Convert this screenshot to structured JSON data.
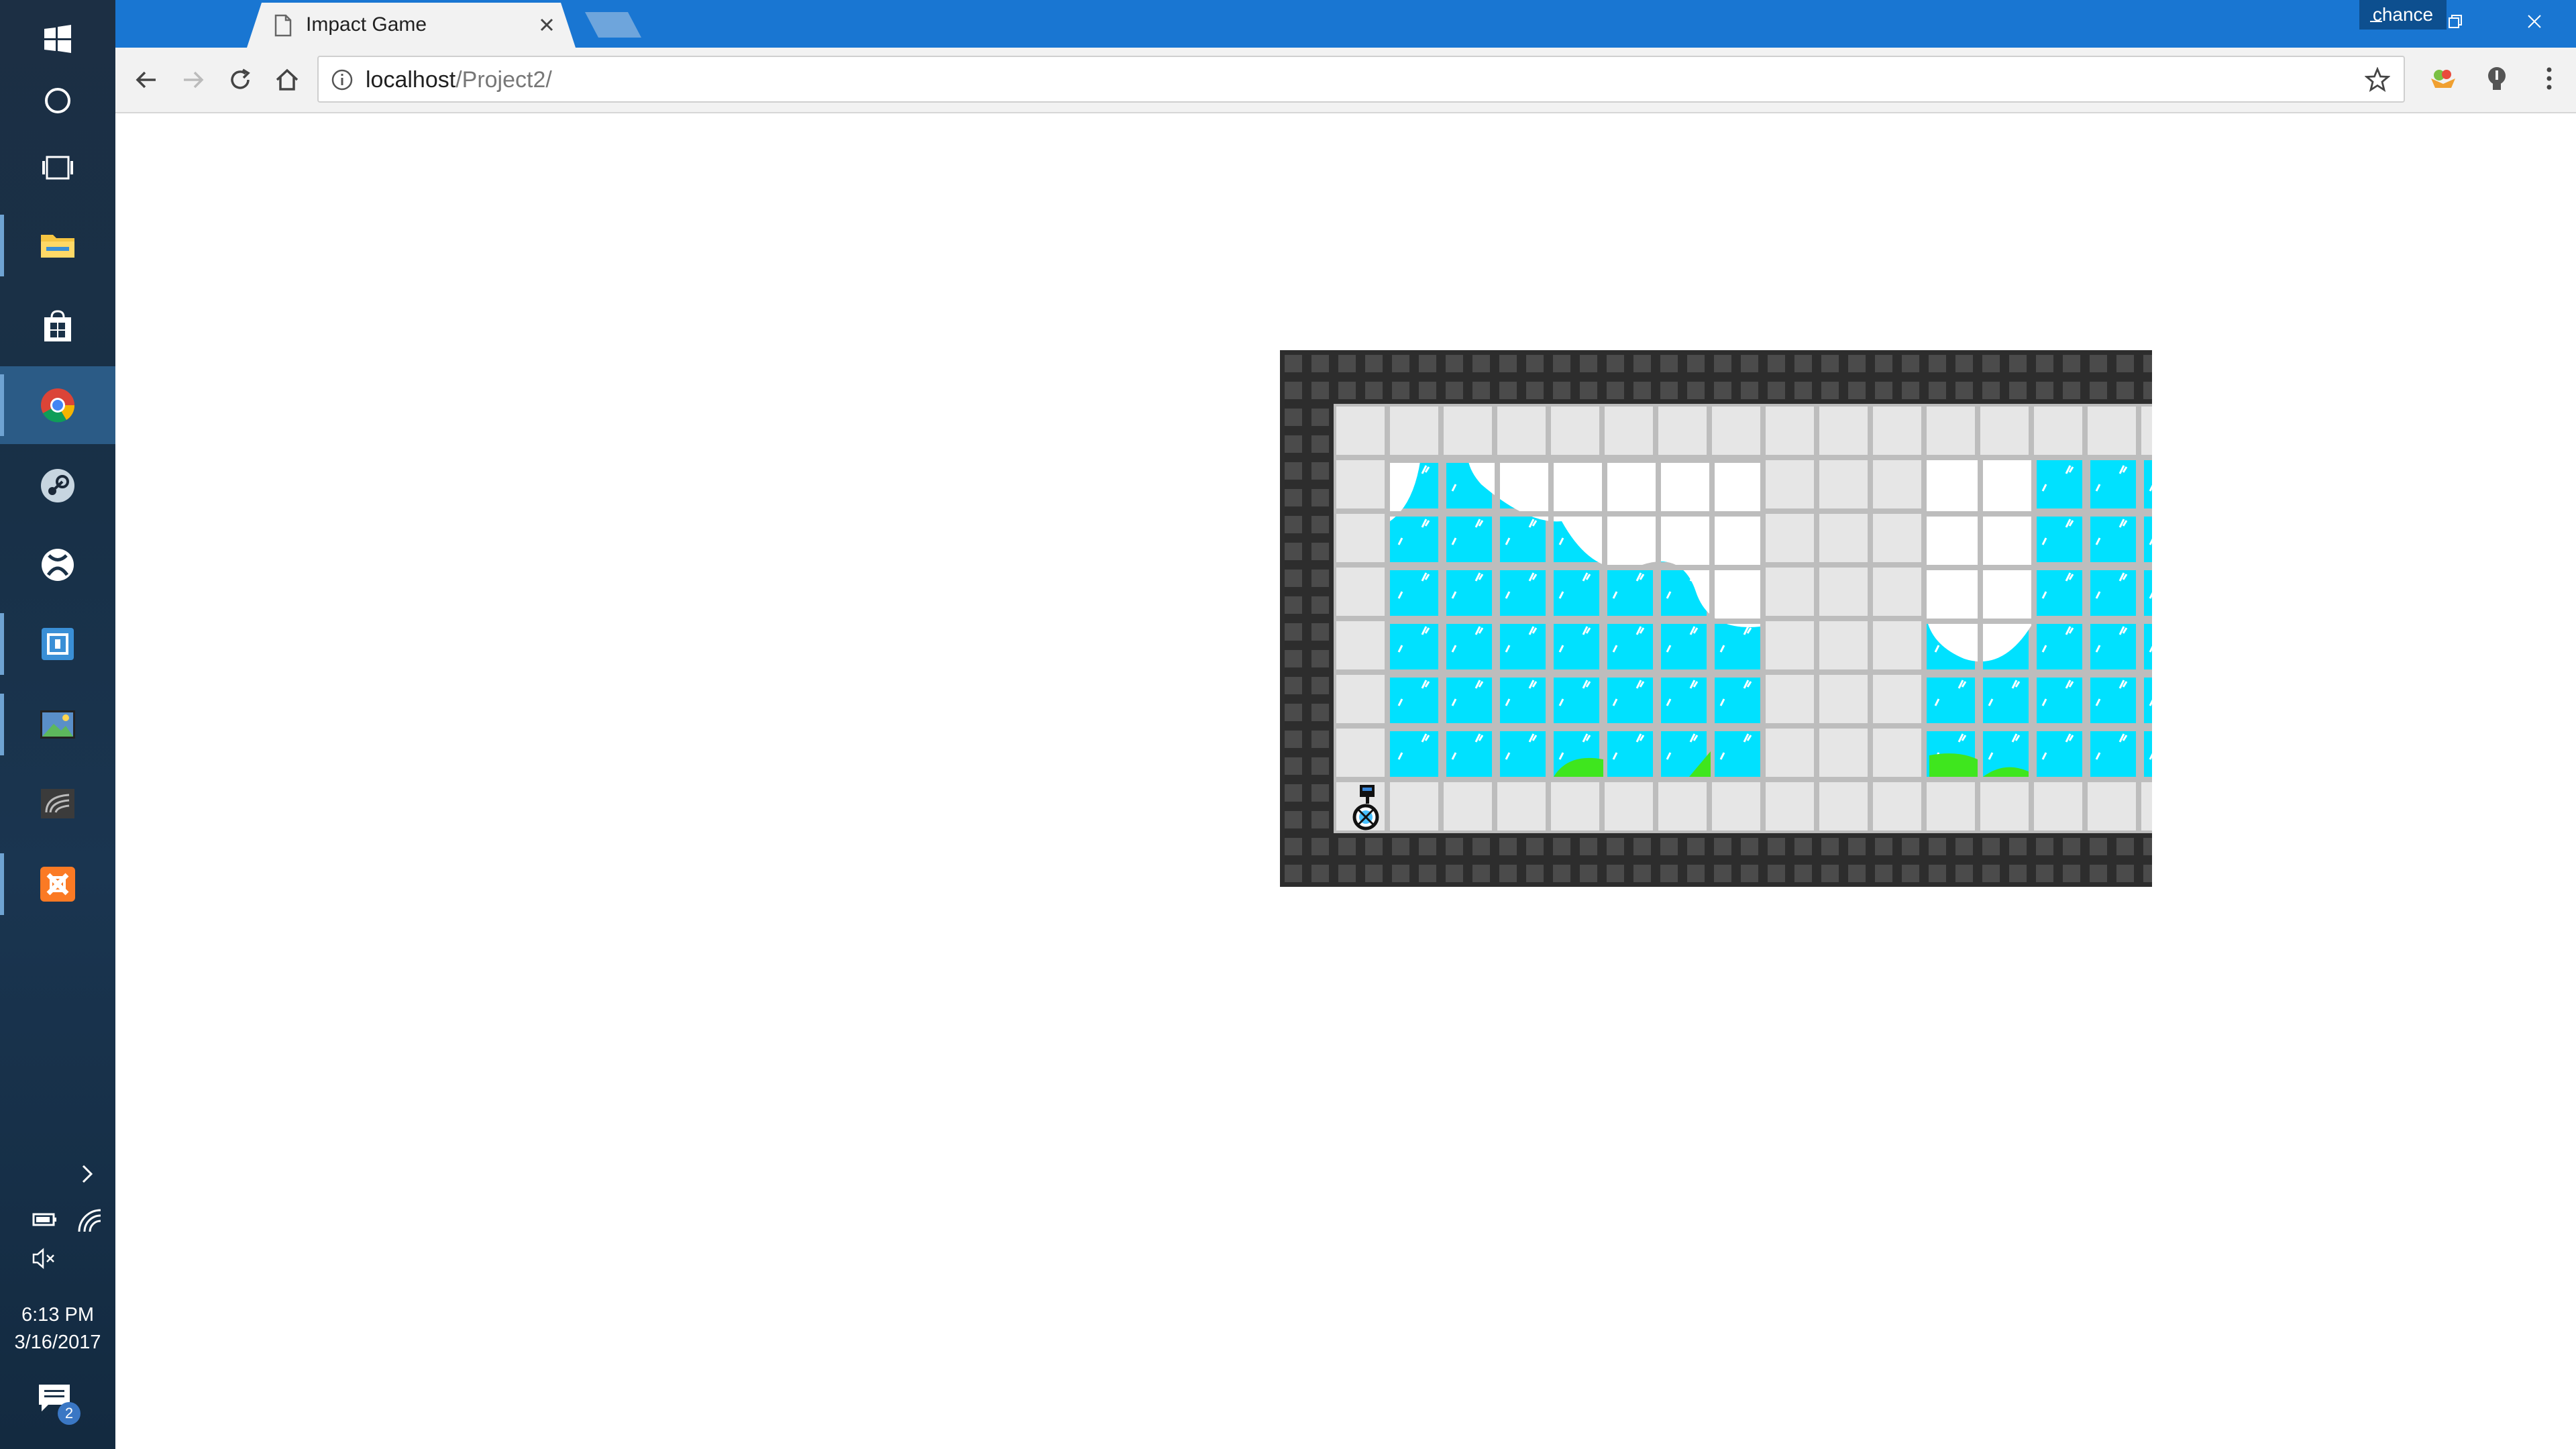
{
  "taskbar": {
    "items": [
      {
        "icon": "windows-start-icon",
        "state": "none"
      },
      {
        "icon": "cortana-circle-icon",
        "state": "none"
      },
      {
        "icon": "task-view-icon",
        "state": "none"
      },
      {
        "icon": "file-explorer-icon",
        "state": "open"
      },
      {
        "icon": "store-icon",
        "state": "none"
      },
      {
        "icon": "chrome-icon",
        "state": "active"
      },
      {
        "icon": "steam-icon",
        "state": "none"
      },
      {
        "icon": "xbox-icon",
        "state": "none"
      },
      {
        "icon": "app-square-icon",
        "state": "open"
      },
      {
        "icon": "photos-icon",
        "state": "open"
      },
      {
        "icon": "nvidia-icon",
        "state": "none"
      },
      {
        "icon": "xampp-icon",
        "state": "open"
      }
    ],
    "clock_time": "6:13 PM",
    "clock_date": "3/16/2017",
    "notification_count": "2"
  },
  "browser": {
    "tab_title": "Impact Game",
    "profile_name": "chance",
    "url_host": "localhost",
    "url_path": "/Project2/"
  },
  "colors": {
    "titlebar": "#1976d2",
    "wall": "#2d2d2d",
    "wall_block": "#4a4a4a",
    "floor": "#e6e6e6",
    "grid_line": "#bdbdbd",
    "water": "#00e1ff",
    "grass": "#3fe61e"
  },
  "game": {
    "cols": 16,
    "rows": 10,
    "tile_size_note": "grid",
    "map": [
      "WWWWWWWWWWWWWWWW",
      "W...............",
      "W.WWWW....WWWWW.",
      "W.WWWW....WWWWW.",
      "W.WWWW....WWWWW.",
      "W.WWWW....WWWWW.",
      "W.WWWW....WWWWW.",
      "W.WWWW....WWWWW.",
      "WP..............",
      "WWWWWWWWWWWWWWWW"
    ]
  }
}
